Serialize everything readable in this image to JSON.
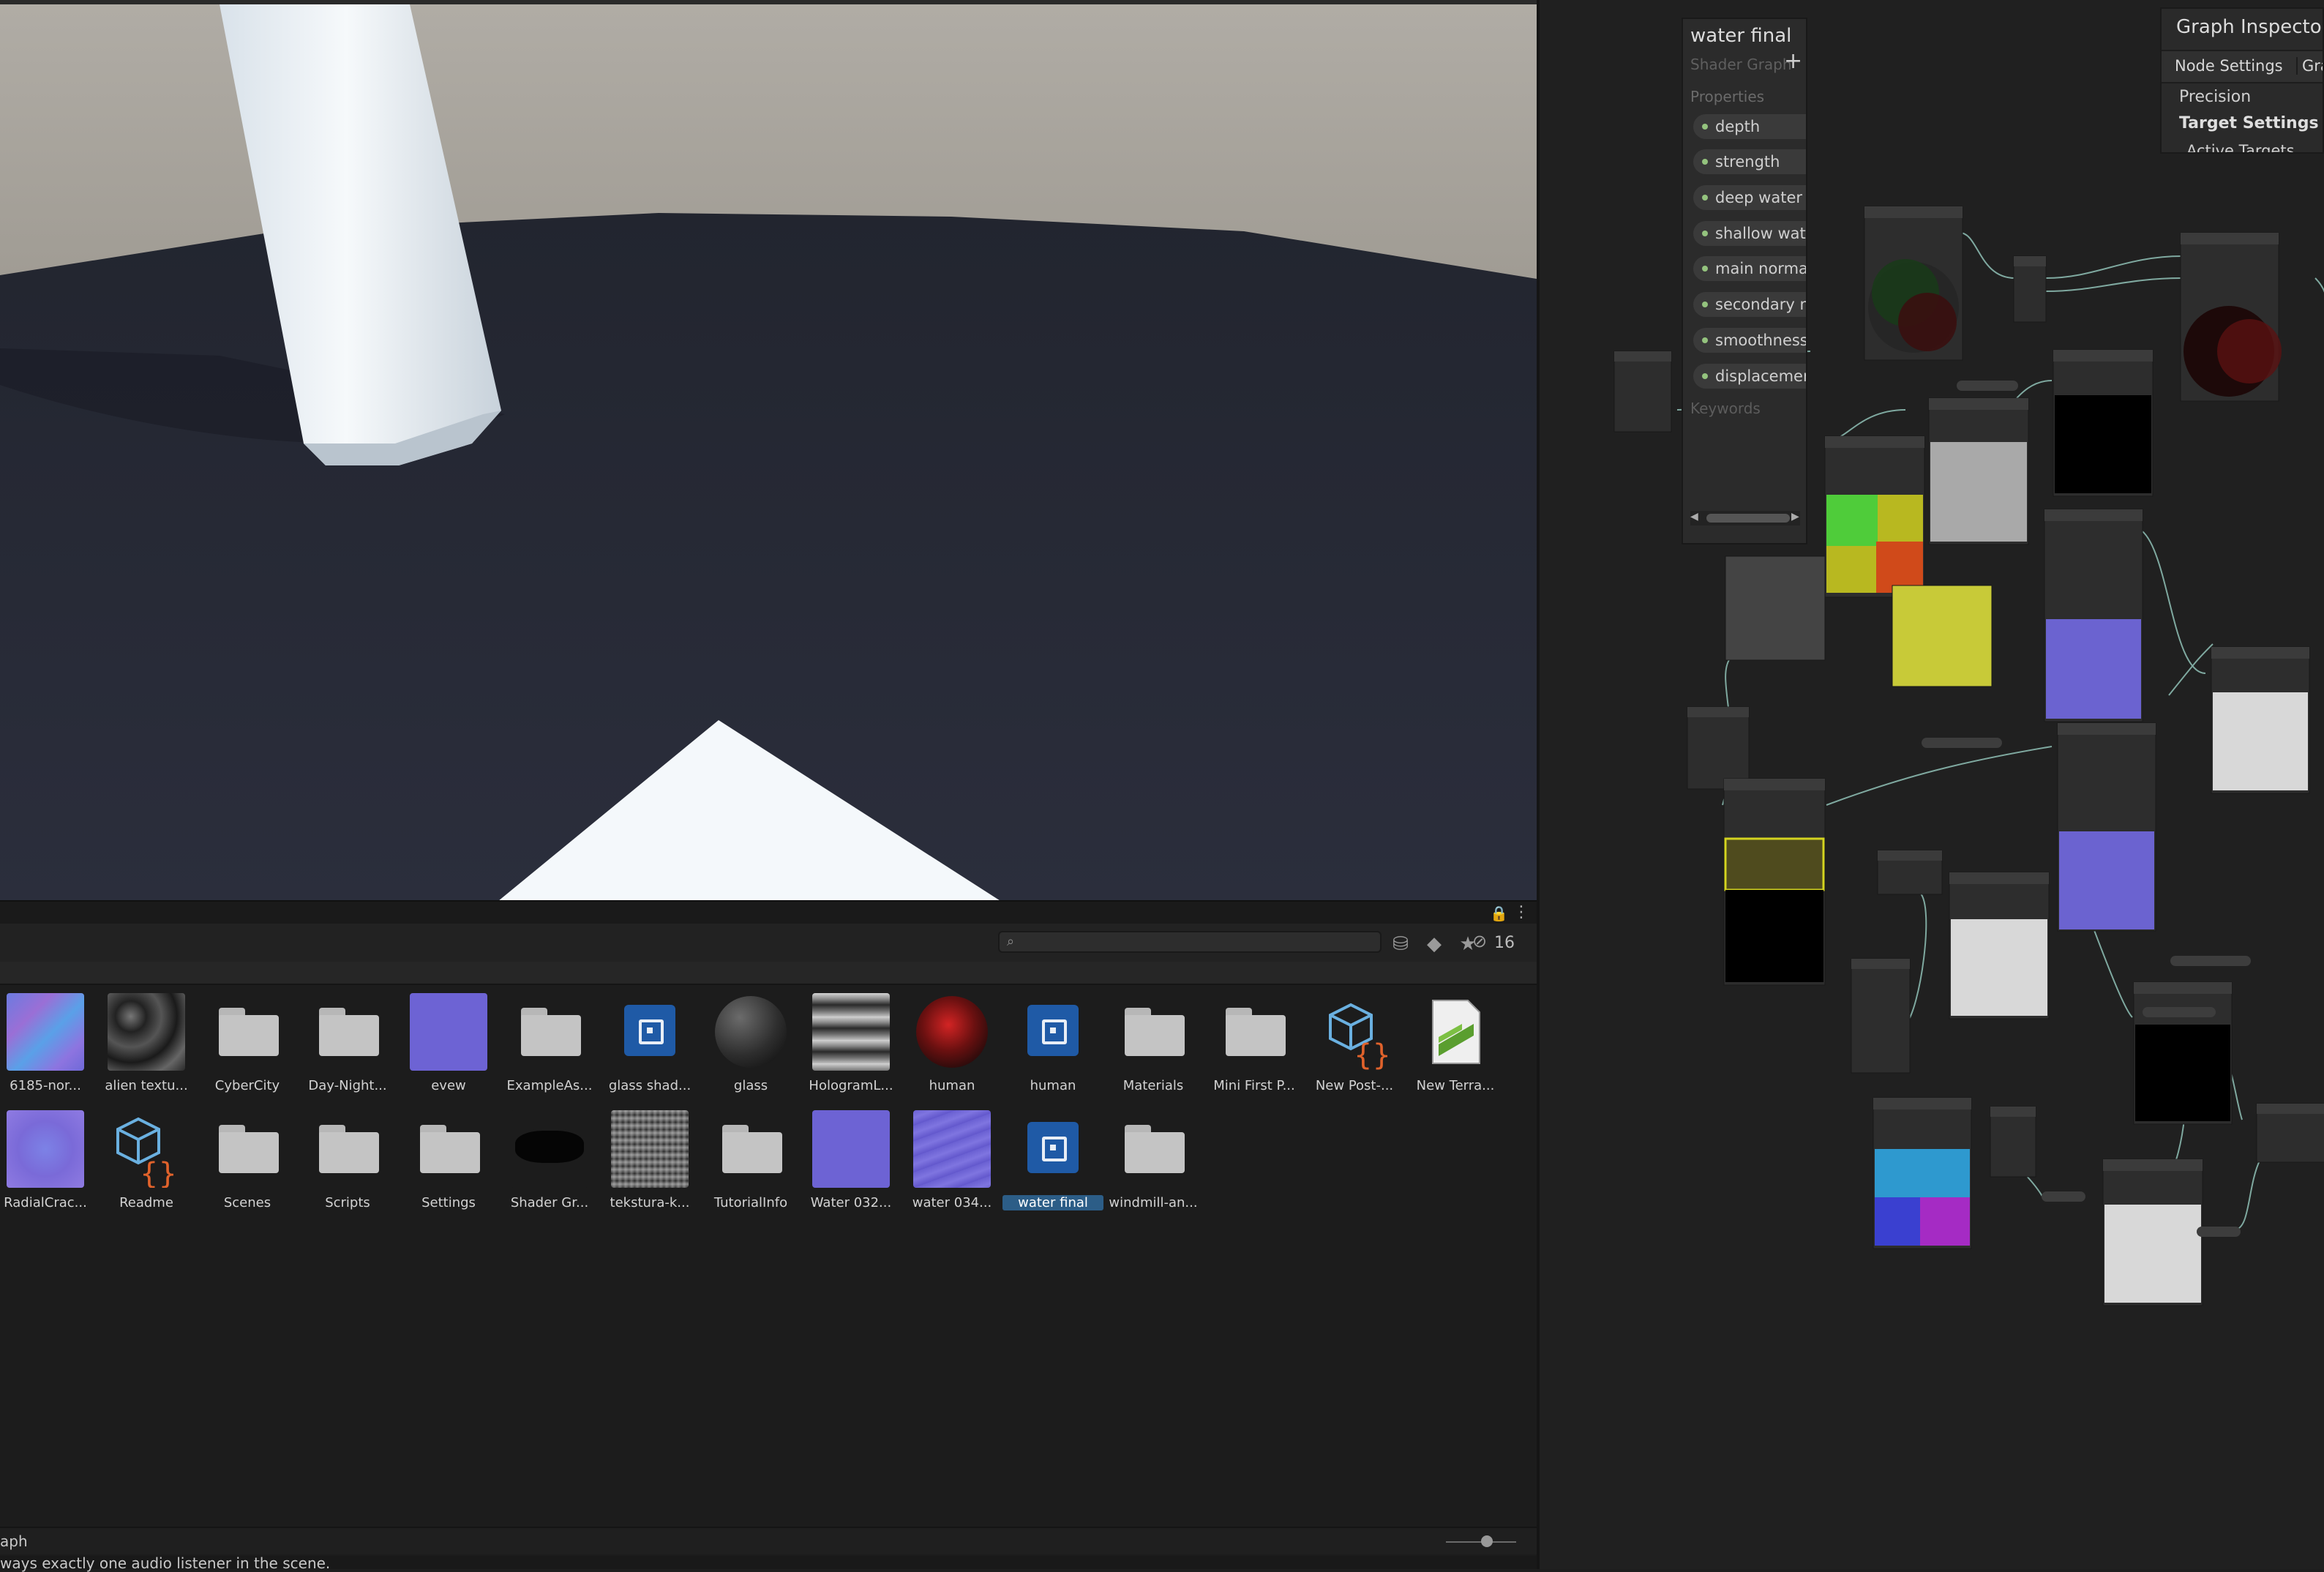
{
  "scene": {
    "sky_top": "#a39f98",
    "horizon": "#807a70",
    "ground": "#272a38",
    "pillar": "#f0f4f7",
    "triangle": "#f4f8fb"
  },
  "project_browser": {
    "hidden_count": "16",
    "assets_row1": [
      {
        "label": "6185-nor...",
        "icon": "texture-normal-icon"
      },
      {
        "label": "alien textu...",
        "icon": "texture-dark-icon"
      },
      {
        "label": "CyberCity",
        "icon": "folder-icon"
      },
      {
        "label": "Day-Night...",
        "icon": "folder-icon"
      },
      {
        "label": "evew",
        "icon": "material-purple-icon"
      },
      {
        "label": "ExampleAs...",
        "icon": "folder-icon"
      },
      {
        "label": "glass shad...",
        "icon": "shader-graph-icon"
      },
      {
        "label": "glass",
        "icon": "material-sphere-icon"
      },
      {
        "label": "HologramL...",
        "icon": "texture-stripes-icon"
      },
      {
        "label": "human",
        "icon": "material-red-sphere-icon"
      },
      {
        "label": "human",
        "icon": "shader-graph-icon"
      },
      {
        "label": "Materials",
        "icon": "folder-icon"
      },
      {
        "label": "Mini First P...",
        "icon": "folder-icon"
      },
      {
        "label": "New Post-...",
        "icon": "volume-profile-icon"
      },
      {
        "label": "New Terra...",
        "icon": "terrain-layer-icon"
      }
    ],
    "assets_row2": [
      {
        "label": "RadialCrac...",
        "icon": "texture-normal-icon"
      },
      {
        "label": "Readme",
        "icon": "script-asset-icon"
      },
      {
        "label": "Scenes",
        "icon": "folder-icon"
      },
      {
        "label": "Scripts",
        "icon": "folder-icon"
      },
      {
        "label": "Settings",
        "icon": "folder-icon"
      },
      {
        "label": "Shader Gr...",
        "icon": "texture-blob-icon"
      },
      {
        "label": "tekstura-k...",
        "icon": "texture-noise-icon"
      },
      {
        "label": "TutorialInfo",
        "icon": "folder-icon"
      },
      {
        "label": "Water 032...",
        "icon": "material-purple-icon"
      },
      {
        "label": "water 034...",
        "icon": "texture-water-icon"
      },
      {
        "label": "water final",
        "icon": "shader-graph-icon",
        "selected": true
      },
      {
        "label": "windmill-an...",
        "icon": "folder-icon"
      }
    ]
  },
  "status": {
    "tab_label": "aph",
    "console_message": "ways exactly one audio listener in the scene."
  },
  "blackboard": {
    "title": "water final",
    "subtitle": "Shader Graph",
    "add_symbol": "+",
    "properties_label": "Properties",
    "properties": [
      "depth",
      "strength",
      "deep water c",
      "shallow wate",
      "main normal",
      "secondary no",
      "smoothness",
      "displacemen"
    ],
    "keywords_label": "Keywords"
  },
  "inspector": {
    "title": "Graph Inspector",
    "tab_node": "Node Settings",
    "tab_graph": "Gra",
    "precision": "Precision",
    "target_settings": "Target Settings",
    "active_targets": "Active Targets"
  }
}
